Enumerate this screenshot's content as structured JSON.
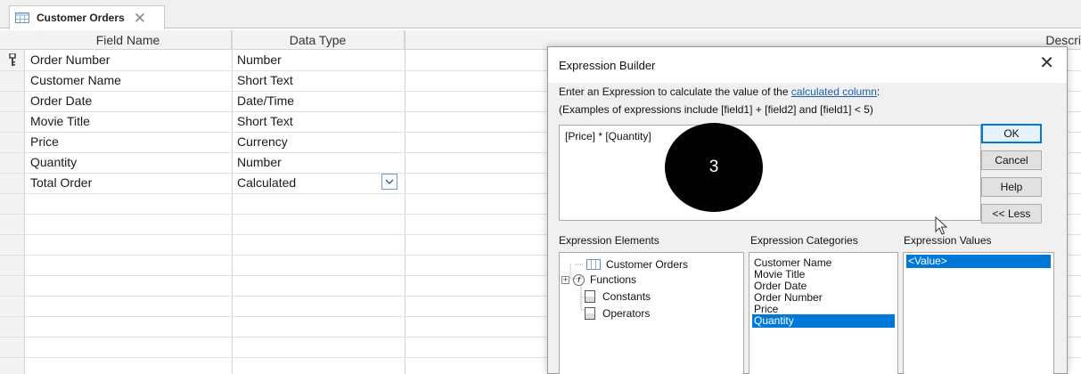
{
  "tab": {
    "label": "Customer Orders",
    "close_glyph": "✕"
  },
  "table": {
    "headers": {
      "field_name": "Field Name",
      "data_type": "Data Type",
      "description": "Descri"
    },
    "rows": [
      {
        "field": "Order Number",
        "type": "Number"
      },
      {
        "field": "Customer Name",
        "type": "Short Text"
      },
      {
        "field": "Order Date",
        "type": "Date/Time"
      },
      {
        "field": "Movie Title",
        "type": "Short Text"
      },
      {
        "field": "Price",
        "type": "Currency"
      },
      {
        "field": "Quantity",
        "type": "Number"
      },
      {
        "field": "Total Order",
        "type": "Calculated"
      }
    ]
  },
  "dialog": {
    "title": "Expression Builder",
    "close_glyph": "✕",
    "instruction_prefix": "Enter an Expression to calculate the value of the ",
    "instruction_link": "calculated column",
    "instruction_suffix": ":",
    "examples": "(Examples of expressions include [field1] + [field2] and [field1] < 5)",
    "expression": "[Price] * [Quantity]",
    "buttons": {
      "ok": "OK",
      "cancel": "Cancel",
      "help": "Help",
      "less": "<< Less"
    },
    "elements_label": "Expression Elements",
    "elements": [
      "Customer Orders",
      "Functions",
      "Constants",
      "Operators"
    ],
    "categories_label": "Expression Categories",
    "categories": [
      "Customer Name",
      "Movie Title",
      "Order Date",
      "Order Number",
      "Price",
      "Quantity"
    ],
    "selected_category": "Quantity",
    "values_label": "Expression Values",
    "values": [
      "<Value>"
    ]
  },
  "overlay": {
    "step_number": "3"
  }
}
